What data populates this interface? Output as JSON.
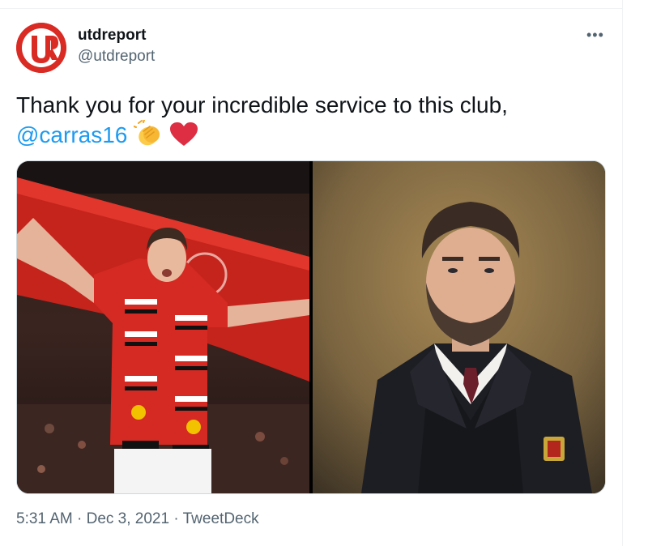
{
  "tweet": {
    "display_name": "utdreport",
    "handle": "@utdreport",
    "more_label": "•••",
    "text_before": "Thank you for your incredible service to this club,",
    "mention": "@carras16",
    "emojis": [
      "clapping-hands-emoji",
      "red-heart-emoji"
    ],
    "time": "5:31 AM",
    "separator": "·",
    "date": "Dec 3, 2021",
    "source": "TweetDeck"
  },
  "colors": {
    "brand_red": "#d92b24",
    "link_blue": "#1d9bf0",
    "secondary_text": "#536471"
  }
}
